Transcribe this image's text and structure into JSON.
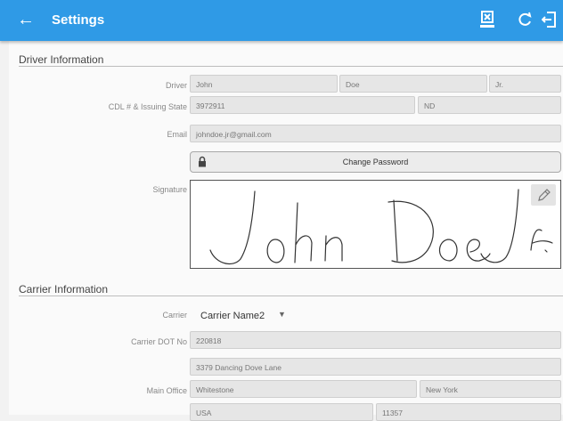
{
  "header": {
    "title": "Settings",
    "back_icon": "arrow-left-icon",
    "actions": [
      "document-x-icon",
      "refresh-icon",
      "logout-icon"
    ]
  },
  "driver_section": {
    "title": "Driver Information",
    "driver_label": "Driver",
    "first_name": "John",
    "last_name": "Doe",
    "suffix": "Jr.",
    "cdl_label": "CDL # & Issuing State",
    "cdl_number": "3972911",
    "cdl_state": "ND",
    "email_label": "Email",
    "email": "johndoe.jr@gmail.com",
    "change_password_label": "Change Password",
    "signature_label": "Signature"
  },
  "carrier_section": {
    "title": "Carrier Information",
    "carrier_label": "Carrier",
    "carrier_value": "Carrier Name2",
    "dot_label": "Carrier DOT No",
    "dot_value": "220818",
    "main_office_label": "Main Office",
    "address": "3379 Dancing Dove Lane",
    "city": "Whitestone",
    "state": "New York",
    "country": "USA",
    "zip": "11357"
  }
}
